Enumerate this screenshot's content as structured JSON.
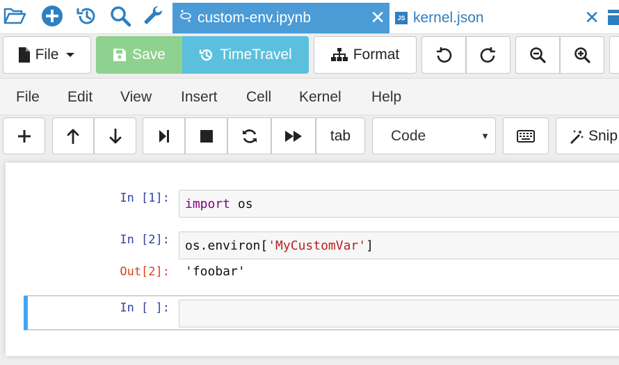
{
  "tabs": [
    {
      "label": "custom-env.ipynb",
      "icon": "notebook-icon",
      "active": true
    },
    {
      "label": "kernel.json",
      "icon": "js-file-icon",
      "active": false
    }
  ],
  "tab_close_glyph": "✕",
  "js_badge": "JS",
  "toolbar": {
    "file_label": "File",
    "save_label": "Save",
    "timetravel_label": "TimeTravel",
    "format_label": "Format"
  },
  "menu": [
    "File",
    "Edit",
    "View",
    "Insert",
    "Cell",
    "Kernel",
    "Help"
  ],
  "cell_toolbar": {
    "tab_label": "tab",
    "cell_type": "Code",
    "snippets_label": "Snip"
  },
  "cells": [
    {
      "prompt": "In [1]:",
      "code": [
        {
          "t": "import",
          "c": "kw"
        },
        {
          "t": " os",
          "c": "plain"
        }
      ]
    },
    {
      "prompt": "In [2]:",
      "code": [
        {
          "t": "os.environ[",
          "c": "plain"
        },
        {
          "t": "'MyCustomVar'",
          "c": "str"
        },
        {
          "t": "]",
          "c": "plain"
        }
      ],
      "out_prompt": "Out[2]:",
      "output": "'foobar'"
    },
    {
      "prompt": "In [ ]:",
      "code": []
    }
  ],
  "colors": {
    "accent": "#4a9bd6",
    "save": "#8fd18f",
    "timetravel": "#5bc0de",
    "in_prompt": "#303f9f",
    "out_prompt": "#d84315",
    "selected_cell": "#42a5f5"
  }
}
